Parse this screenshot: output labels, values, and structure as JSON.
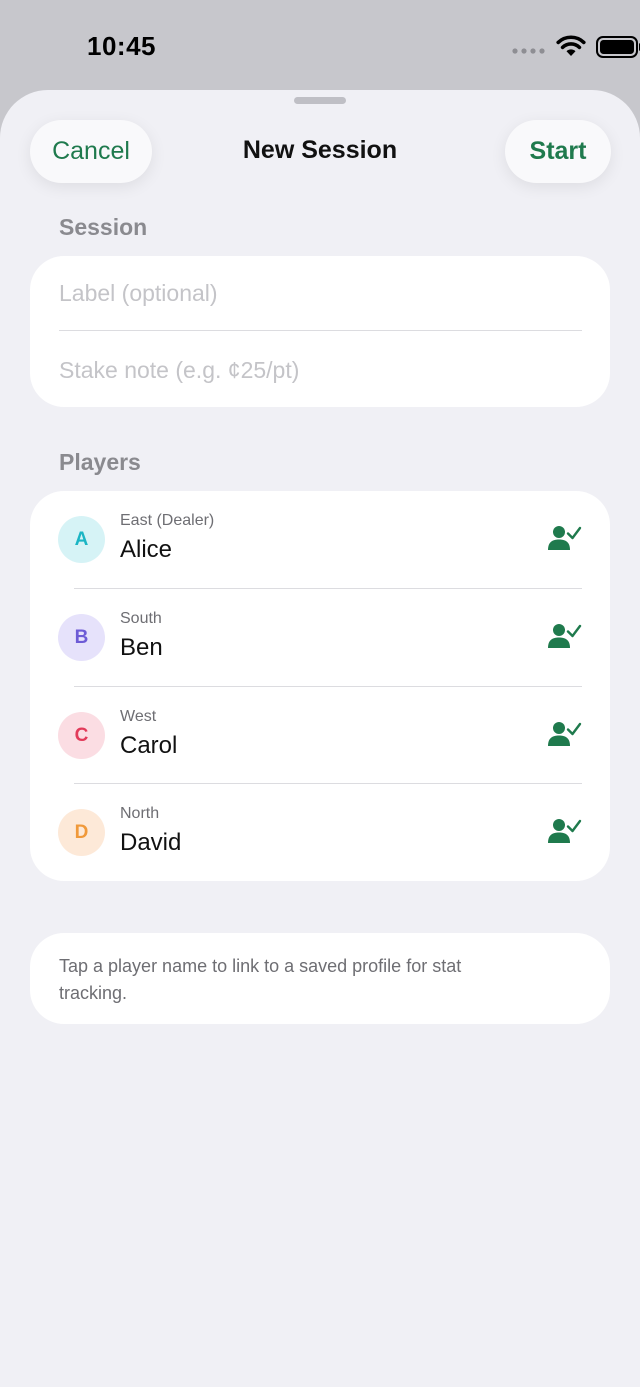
{
  "status_bar": {
    "time": "10:45",
    "icons": [
      "signal-icon",
      "wifi-icon",
      "battery-icon"
    ]
  },
  "header": {
    "cancel_label": "Cancel",
    "title": "New Session",
    "start_label": "Start"
  },
  "session": {
    "header": "Session",
    "label_placeholder": "Label (optional)",
    "stake_placeholder": "Stake note (e.g. ¢25/pt)"
  },
  "players": {
    "header": "Players",
    "items": [
      {
        "initial": "A",
        "seat": "East (Dealer)",
        "name": "Alice",
        "avatar_bg": "#d6f3f6",
        "avatar_fg": "#1bb5c4"
      },
      {
        "initial": "B",
        "seat": "South",
        "name": "Ben",
        "avatar_bg": "#e6e2fb",
        "avatar_fg": "#6d5bd6"
      },
      {
        "initial": "C",
        "seat": "West",
        "name": "Carol",
        "avatar_bg": "#fbdde3",
        "avatar_fg": "#e23b5a"
      },
      {
        "initial": "D",
        "seat": "North",
        "name": "David",
        "avatar_bg": "#fde9d8",
        "avatar_fg": "#f0993a"
      }
    ],
    "link_icon": "person-check-icon"
  },
  "hint": {
    "text": "Tap a player name to link to a saved profile for stat tracking."
  },
  "colors": {
    "accent": "#1f7a4d",
    "background": "#f0f0f5",
    "card": "#ffffff"
  }
}
